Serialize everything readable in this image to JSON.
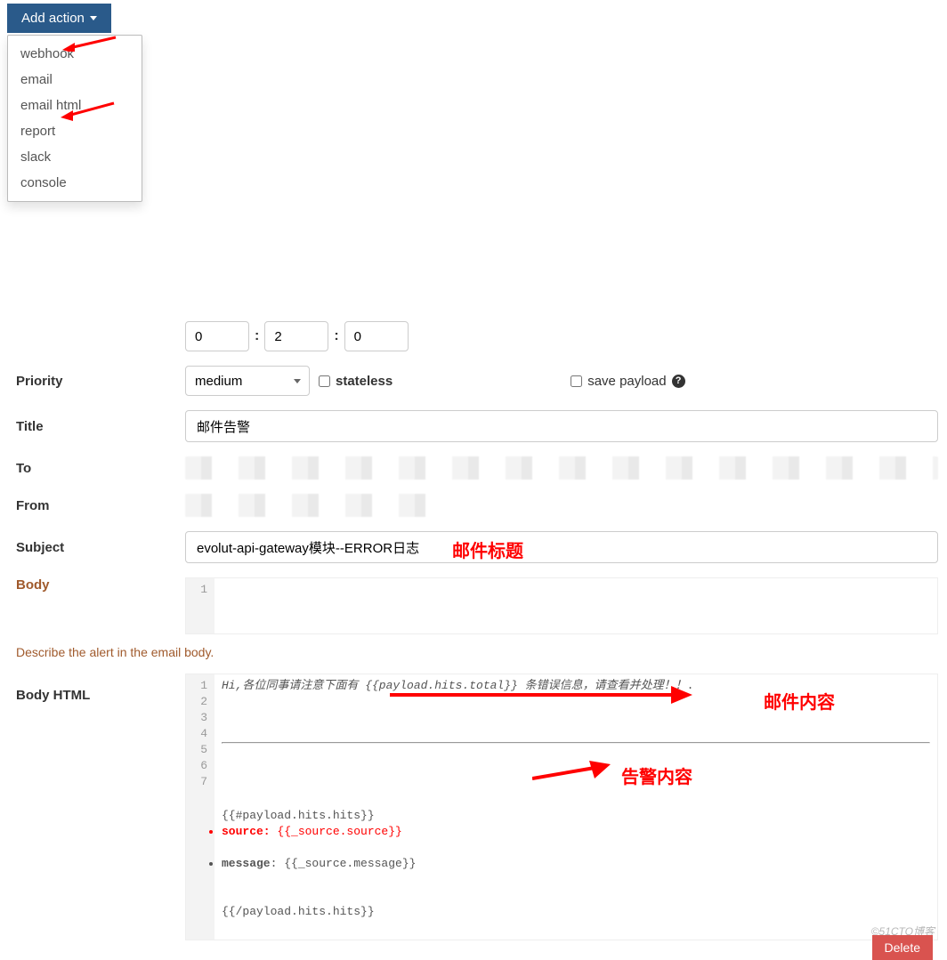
{
  "add_action": {
    "label": "Add action",
    "menu": [
      "webhook",
      "email",
      "email html",
      "report",
      "slack",
      "console"
    ]
  },
  "time": {
    "h": "0",
    "m": "2",
    "s": "0"
  },
  "form": {
    "priority_label": "Priority",
    "priority_value": "medium",
    "stateless_label": "stateless",
    "save_payload_label": "save payload",
    "title_label": "Title",
    "title_value": "邮件告警",
    "to_label": "To",
    "from_label": "From",
    "subject_label": "Subject",
    "subject_value": "evolut-api-gateway模块--ERROR日志",
    "body_label": "Body",
    "body_html_label": "Body HTML",
    "helper_text": "Describe the alert in the email body."
  },
  "body_editor": {
    "gutter": [
      "1"
    ],
    "content": ""
  },
  "body_html_editor": {
    "gutter": [
      "1",
      "2",
      "3",
      "4",
      "5",
      "6",
      "",
      "7"
    ],
    "lines": [
      "<p><i>Hi,各位同事请注意下面有 {{payload.hits.total}} 条错误信息，请查看并处理！！</i>.</p>",
      "<div style=\"color:grey;\">",
      "  <hr />",
      "</div>",
      "<div>",
      "<br>{{#payload.hits.hits}} <li style='color:red'><b>source:</b> {{_source.source}} </li><br><li><b>message</b>: {{_source.message}}</li><br><br>{{/payload.hits.hits}}",
      "",
      "</div>"
    ]
  },
  "annotations": {
    "subject": "邮件标题",
    "content": "邮件内容",
    "alert": "告警内容"
  },
  "watermark": "©51CTO博客",
  "delete_label": "Delete"
}
